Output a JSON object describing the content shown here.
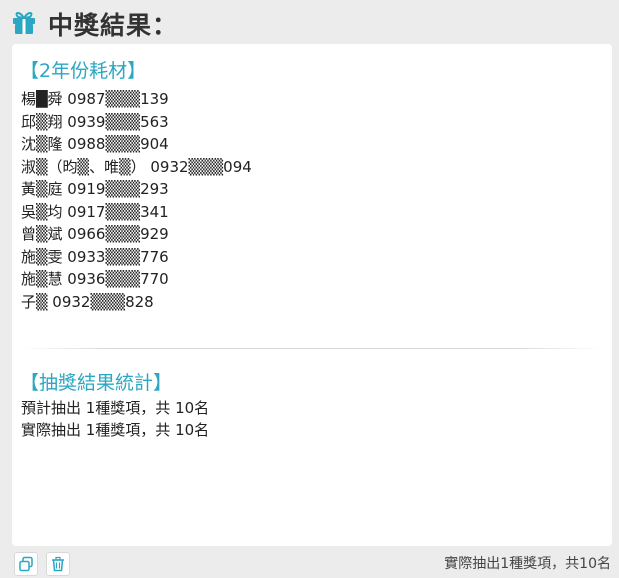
{
  "header": {
    "title": "中獎結果：",
    "icon": "gift-icon"
  },
  "colors": {
    "accent": "#2aa7c2",
    "background": "#ececec",
    "card": "#ffffff"
  },
  "prize_section": {
    "title": "【2年份耗材】",
    "winners": [
      "楊█舜 0987▒▒▒139",
      "邱▒翔 0939▒▒▒563",
      "沈▒隆 0988▒▒▒904",
      "淑▒（昀▒、唯▒） 0932▒▒▒094",
      "黃▒庭 0919▒▒▒293",
      "吳▒均 0917▒▒▒341",
      "曾▒斌 0966▒▒▒929",
      "施▒雯 0933▒▒▒776",
      "施▒慧 0936▒▒▒770",
      "子▒ 0932▒▒▒828"
    ]
  },
  "stats_section": {
    "title": "【抽獎結果統計】",
    "planned": "預計抽出 1種獎項，共 10名",
    "actual": "實際抽出 1種獎項，共 10名"
  },
  "footer": {
    "copy_icon": "copy-icon",
    "delete_icon": "trash-icon",
    "status": "實際抽出1種獎項，共10名"
  }
}
